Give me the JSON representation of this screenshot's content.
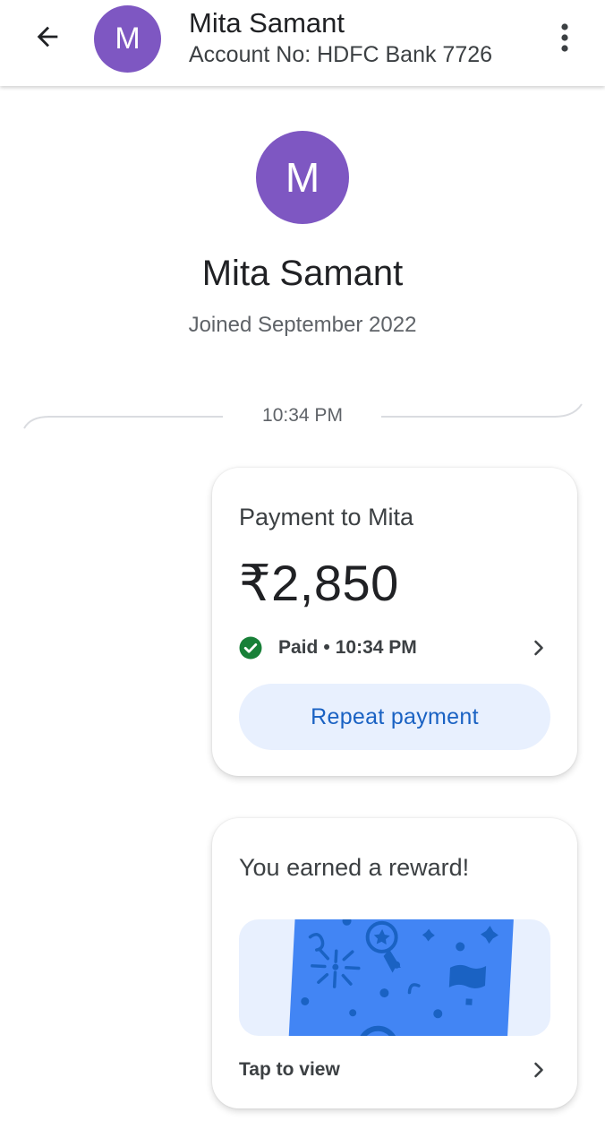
{
  "header": {
    "avatar_initial": "M",
    "name": "Mita Samant",
    "account": "Account No: HDFC Bank 7726",
    "back_icon": "arrow-back-icon",
    "more_icon": "more-vert-icon"
  },
  "profile": {
    "avatar_initial": "M",
    "name": "Mita Samant",
    "joined": "Joined September 2022"
  },
  "conversation": {
    "time_divider": "10:34 PM"
  },
  "payment_card": {
    "title": "Payment to Mita",
    "amount": "₹2,850",
    "status": "Paid",
    "separator": "•",
    "status_time": "10:34 PM",
    "repeat_label": "Repeat payment"
  },
  "reward_card": {
    "title": "You earned a reward!",
    "tap_label": "Tap to view"
  },
  "colors": {
    "avatar": "#7e57c2",
    "accent_blue": "#1a62c3",
    "button_bg": "#e8f0fe",
    "success_green": "#188038",
    "reward_card_blue": "#4285f4"
  }
}
